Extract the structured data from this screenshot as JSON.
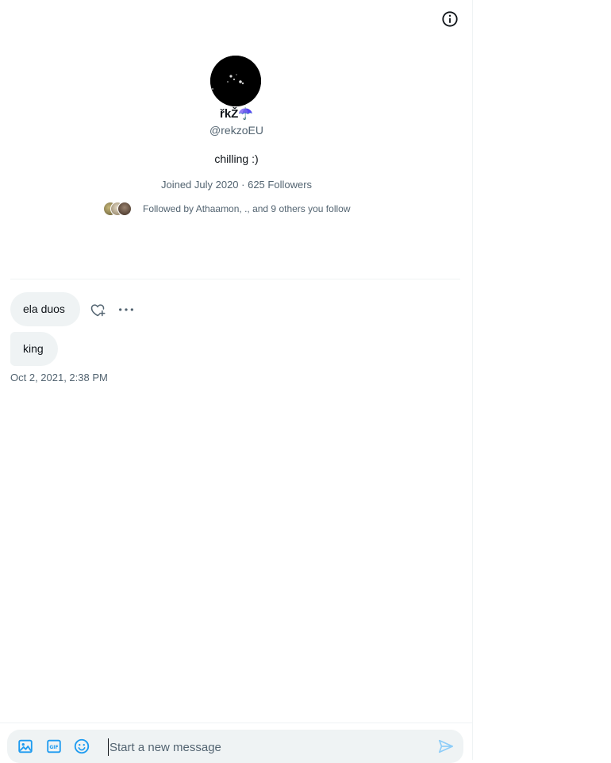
{
  "profile": {
    "name": "řkŽ",
    "name_emoji": "☂️",
    "handle": "@rekzoEU",
    "bio": "chilling :)",
    "meta": "Joined July 2020 · 625 Followers",
    "followed_by": "Followed by Athaamon, ., and 9 others you follow"
  },
  "messages": [
    {
      "text": "ela duos"
    },
    {
      "text": "king"
    }
  ],
  "timestamp": "Oct 2, 2021, 2:38 PM",
  "composer": {
    "placeholder": "Start a new message",
    "value": ""
  },
  "icons": {
    "info": "info-icon",
    "react": "heart-plus-icon",
    "more": "more-horizontal-icon",
    "media": "image-icon",
    "gif": "gif-icon",
    "emoji": "emoji-icon",
    "send": "send-icon"
  },
  "colors": {
    "accent": "#1d9bf0",
    "bubble": "#eff3f4",
    "secondary_text": "#536471"
  }
}
